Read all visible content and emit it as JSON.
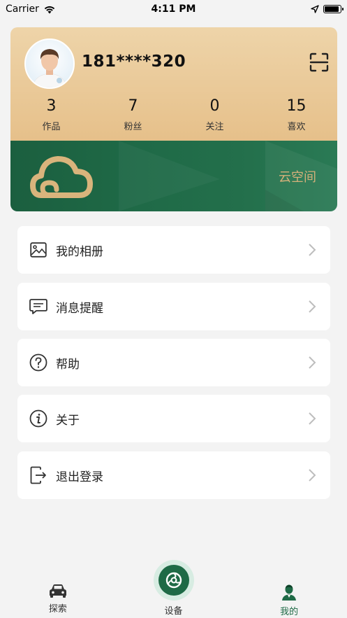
{
  "status_bar": {
    "carrier": "Carrier",
    "time": "4:11 PM",
    "battery_level": 0.95
  },
  "profile": {
    "username": "181****320",
    "stats": [
      {
        "value": "3",
        "label": "作品"
      },
      {
        "value": "7",
        "label": "粉丝"
      },
      {
        "value": "0",
        "label": "关注"
      },
      {
        "value": "15",
        "label": "喜欢"
      }
    ],
    "cloud_label": "云空间"
  },
  "menu": {
    "items": [
      {
        "label": "我的相册",
        "icon": "album-icon"
      },
      {
        "label": "消息提醒",
        "icon": "message-icon"
      },
      {
        "label": "帮助",
        "icon": "help-icon"
      },
      {
        "label": "关于",
        "icon": "info-icon"
      },
      {
        "label": "退出登录",
        "icon": "logout-icon"
      }
    ]
  },
  "tabs": {
    "explore": "探索",
    "device": "设备",
    "mine": "我的"
  },
  "colors": {
    "brand_green": "#1e6a46",
    "gold": "#d5b07a"
  }
}
